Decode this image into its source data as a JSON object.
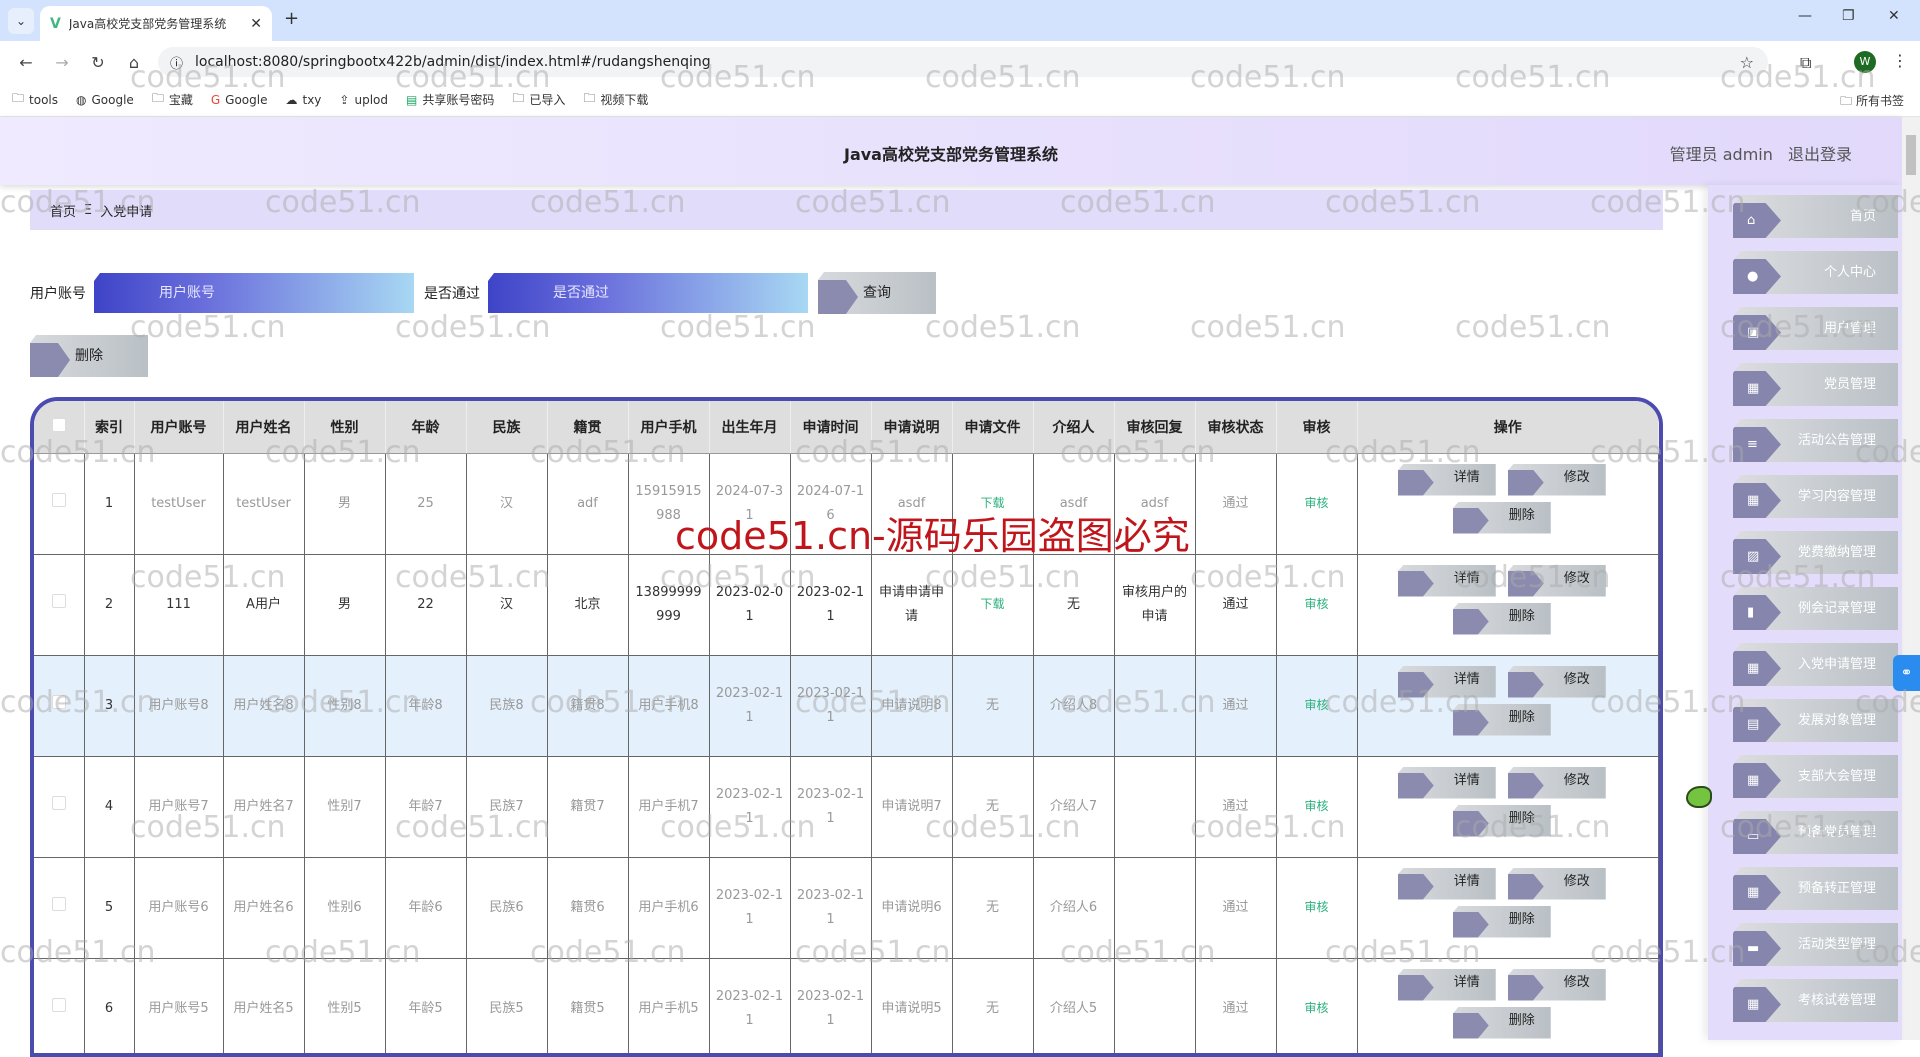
{
  "browser": {
    "tab_title": "Java高校党支部党务管理系统",
    "url": "localhost:8080/springbootx422b/admin/dist/index.html#/rudangshenqing",
    "bookmarks": [
      {
        "icon": "folder-icon",
        "label": "tools"
      },
      {
        "icon": "globe-icon",
        "label": "Google"
      },
      {
        "icon": "folder-icon",
        "label": "宝藏"
      },
      {
        "icon": "google-icon",
        "label": "Google"
      },
      {
        "icon": "cloud-icon",
        "label": "txy"
      },
      {
        "icon": "upload-icon",
        "label": "uplod"
      },
      {
        "icon": "sheet-icon",
        "label": "共享账号密码"
      },
      {
        "icon": "folder-icon",
        "label": "已导入"
      },
      {
        "icon": "folder-icon",
        "label": "视频下载"
      }
    ],
    "all_bookmarks": "所有书签",
    "profile_initial": "W"
  },
  "header": {
    "title": "Java高校党支部党务管理系统",
    "user": "管理员 admin",
    "logout": "退出登录"
  },
  "breadcrumb": {
    "home": "首页",
    "separator": "Ξ",
    "current": "入党申请"
  },
  "search": {
    "account_label": "用户账号",
    "account_placeholder": "用户账号",
    "passed_label": "是否通过",
    "passed_placeholder": "是否通过",
    "query_button": "查询",
    "delete_button": "删除"
  },
  "table": {
    "columns": [
      "索引",
      "用户账号",
      "用户姓名",
      "性别",
      "年龄",
      "民族",
      "籍贯",
      "用户手机",
      "出生年月",
      "申请时间",
      "申请说明",
      "申请文件",
      "介绍人",
      "审核回复",
      "审核状态",
      "审核",
      "操作"
    ],
    "rows": [
      {
        "index": "1",
        "account": "testUser",
        "name": "testUser",
        "gender": "男",
        "age": "25",
        "ethnic": "汉",
        "origin": "adf",
        "phone": "15915915988",
        "birth": "2024-07-31",
        "apply_time": "2024-07-16",
        "desc": "asdf",
        "file": "下载",
        "introducer": "asdf",
        "reply": "adsf",
        "status": "通过",
        "review": "审核",
        "dark": false,
        "highlight": false
      },
      {
        "index": "2",
        "account": "111",
        "name": "A用户",
        "gender": "男",
        "age": "22",
        "ethnic": "汉",
        "origin": "北京",
        "phone": "13899999999",
        "birth": "2023-02-01",
        "apply_time": "2023-02-11",
        "desc": "申请申请申请",
        "file": "下载",
        "introducer": "无",
        "reply": "审核用户的申请",
        "status": "通过",
        "review": "审核",
        "dark": true,
        "highlight": false
      },
      {
        "index": "3",
        "account": "用户账号8",
        "name": "用户姓名8",
        "gender": "性别8",
        "age": "年龄8",
        "ethnic": "民族8",
        "origin": "籍贯8",
        "phone": "用户手机8",
        "birth": "2023-02-11",
        "apply_time": "2023-02-11",
        "desc": "申请说明8",
        "file": "无",
        "introducer": "介绍人8",
        "reply": "",
        "status": "通过",
        "review": "审核",
        "dark": false,
        "highlight": true
      },
      {
        "index": "4",
        "account": "用户账号7",
        "name": "用户姓名7",
        "gender": "性别7",
        "age": "年龄7",
        "ethnic": "民族7",
        "origin": "籍贯7",
        "phone": "用户手机7",
        "birth": "2023-02-11",
        "apply_time": "2023-02-11",
        "desc": "申请说明7",
        "file": "无",
        "introducer": "介绍人7",
        "reply": "",
        "status": "通过",
        "review": "审核",
        "dark": false,
        "highlight": false
      },
      {
        "index": "5",
        "account": "用户账号6",
        "name": "用户姓名6",
        "gender": "性别6",
        "age": "年龄6",
        "ethnic": "民族6",
        "origin": "籍贯6",
        "phone": "用户手机6",
        "birth": "2023-02-11",
        "apply_time": "2023-02-11",
        "desc": "申请说明6",
        "file": "无",
        "introducer": "介绍人6",
        "reply": "",
        "status": "通过",
        "review": "审核",
        "dark": false,
        "highlight": false
      },
      {
        "index": "6",
        "account": "用户账号5",
        "name": "用户姓名5",
        "gender": "性别5",
        "age": "年龄5",
        "ethnic": "民族5",
        "origin": "籍贯5",
        "phone": "用户手机5",
        "birth": "2023-02-11",
        "apply_time": "2023-02-11",
        "desc": "申请说明5",
        "file": "无",
        "introducer": "介绍人5",
        "reply": "",
        "status": "通过",
        "review": "审核",
        "dark": false,
        "highlight": false
      }
    ],
    "actions": {
      "detail": "详情",
      "edit": "修改",
      "delete": "删除"
    }
  },
  "sidebar": {
    "items": [
      {
        "label": "首页",
        "icon": "home-icon",
        "glyph": "⌂"
      },
      {
        "label": "个人中心",
        "icon": "user-icon",
        "glyph": "●"
      },
      {
        "label": "用户管理",
        "icon": "briefcase-icon",
        "glyph": "▣"
      },
      {
        "label": "党员管理",
        "icon": "grid-icon",
        "glyph": "▦"
      },
      {
        "label": "活动公告管理",
        "icon": "list-icon",
        "glyph": "≡"
      },
      {
        "label": "学习内容管理",
        "icon": "table-icon",
        "glyph": "▦"
      },
      {
        "label": "党费缴纳管理",
        "icon": "clipboard-icon",
        "glyph": "▨"
      },
      {
        "label": "例会记录管理",
        "icon": "book-icon",
        "glyph": "▮"
      },
      {
        "label": "入党申请管理",
        "icon": "grid-icon",
        "glyph": "▦"
      },
      {
        "label": "发展对象管理",
        "icon": "calendar-icon",
        "glyph": "▤"
      },
      {
        "label": "支部大会管理",
        "icon": "grid-icon",
        "glyph": "▦"
      },
      {
        "label": "预备党员管理",
        "icon": "monitor-icon",
        "glyph": "▭"
      },
      {
        "label": "预备转正管理",
        "icon": "grid-icon",
        "glyph": "▦"
      },
      {
        "label": "活动类型管理",
        "icon": "ticket-icon",
        "glyph": "▬"
      },
      {
        "label": "考核试卷管理",
        "icon": "grid-icon",
        "glyph": "▦"
      }
    ]
  },
  "watermark": {
    "text": "code51.cn",
    "banner": "code51.cn-源码乐园盗图必究"
  }
}
